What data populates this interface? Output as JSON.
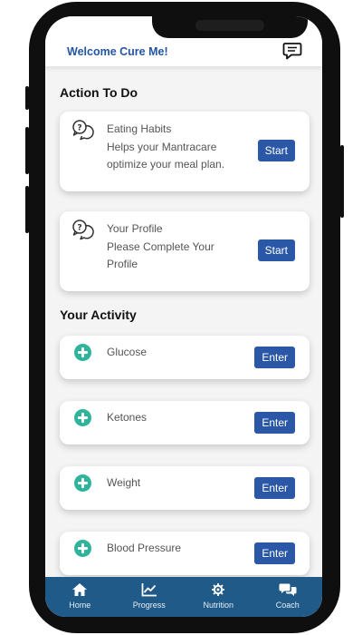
{
  "header": {
    "welcome_text": "Welcome Cure Me!",
    "chat_icon": "chat-icon"
  },
  "action_section": {
    "title": "Action To Do",
    "cards": [
      {
        "title": "Eating Habits",
        "description": "Helps your Mantracare optimize your meal plan.",
        "button_label": "Start",
        "icon": "question-chat-icon"
      },
      {
        "title": "Your Profile",
        "description": "Please Complete Your Profile",
        "button_label": "Start",
        "icon": "question-chat-icon"
      }
    ]
  },
  "activity_section": {
    "title": "Your Activity",
    "items": [
      {
        "label": "Glucose",
        "button_label": "Enter",
        "icon": "plus-circle-icon"
      },
      {
        "label": "Ketones",
        "button_label": "Enter",
        "icon": "plus-circle-icon"
      },
      {
        "label": "Weight",
        "button_label": "Enter",
        "icon": "plus-circle-icon"
      },
      {
        "label": "Blood Pressure",
        "button_label": "Enter",
        "icon": "plus-circle-icon"
      }
    ]
  },
  "bottom_nav": {
    "items": [
      {
        "label": "Home",
        "icon": "home-icon"
      },
      {
        "label": "Progress",
        "icon": "chart-icon"
      },
      {
        "label": "Nutrition",
        "icon": "nutrition-icon"
      },
      {
        "label": "Coach",
        "icon": "coach-chat-icon"
      }
    ]
  },
  "colors": {
    "brand_blue": "#2355a5",
    "button_blue": "#2a57a6",
    "plus_green": "#2fb49b",
    "nav_bg": "#1f5a88"
  }
}
